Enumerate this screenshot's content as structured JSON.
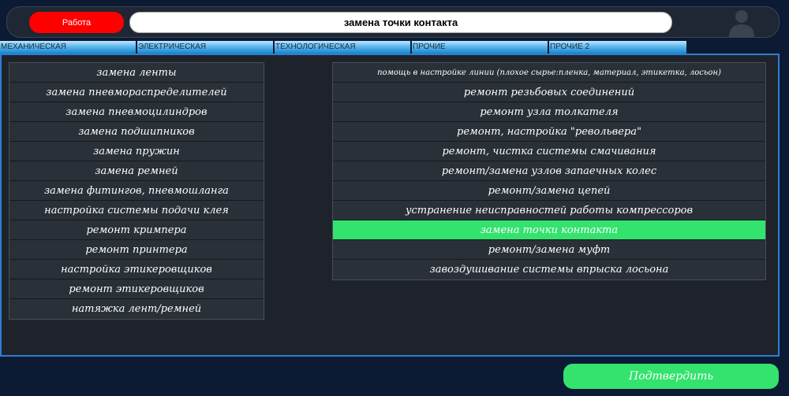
{
  "header": {
    "status_label": "Работа",
    "status_color": "#ff0000",
    "title": "замена точки контакта",
    "avatar_icon": "user-avatar-icon"
  },
  "tabs": [
    {
      "label": "МЕХАНИЧЕСКАЯ"
    },
    {
      "label": "ЭЛЕКТРИЧЕСКАЯ"
    },
    {
      "label": "ТЕХНОЛОГИЧЕСКАЯ"
    },
    {
      "label": "ПРОЧИЕ"
    },
    {
      "label": "ПРОЧИЕ 2"
    }
  ],
  "left_list": [
    "замена ленты",
    "замена пневмораспределителей",
    "замена пневмоцилиндров",
    "замена подшипников",
    "замена пружин",
    "замена ремней",
    "замена фитингов, пневмошланга",
    "настройка системы подачи клея",
    "ремонт кримпера",
    "ремонт принтера",
    "настройка этикеровщиков",
    "ремонт этикеровщиков",
    "натяжка лент/ремней"
  ],
  "right_list": [
    "помощь в настройке линии (плохое сырье:пленка, материал, этикетка, лосьон)",
    "ремонт резьбовых соединений",
    "ремонт узла толкателя",
    "ремонт, настройка \"револьвера\"",
    "ремонт, чистка системы смачивания",
    "ремонт/замена узлов запаечных колес",
    "ремонт/замена цепей",
    "устранение неисправностей работы компрессоров",
    "замена точки контакта",
    "ремонт/замена муфт",
    "завоздушивание системы впрыска лосьона"
  ],
  "selected_item": "замена точки контакта",
  "confirm_label": "Подтвердить",
  "colors": {
    "accent_green": "#33e36e",
    "panel_border": "#2f7ed0",
    "background": "#0c1a33"
  }
}
